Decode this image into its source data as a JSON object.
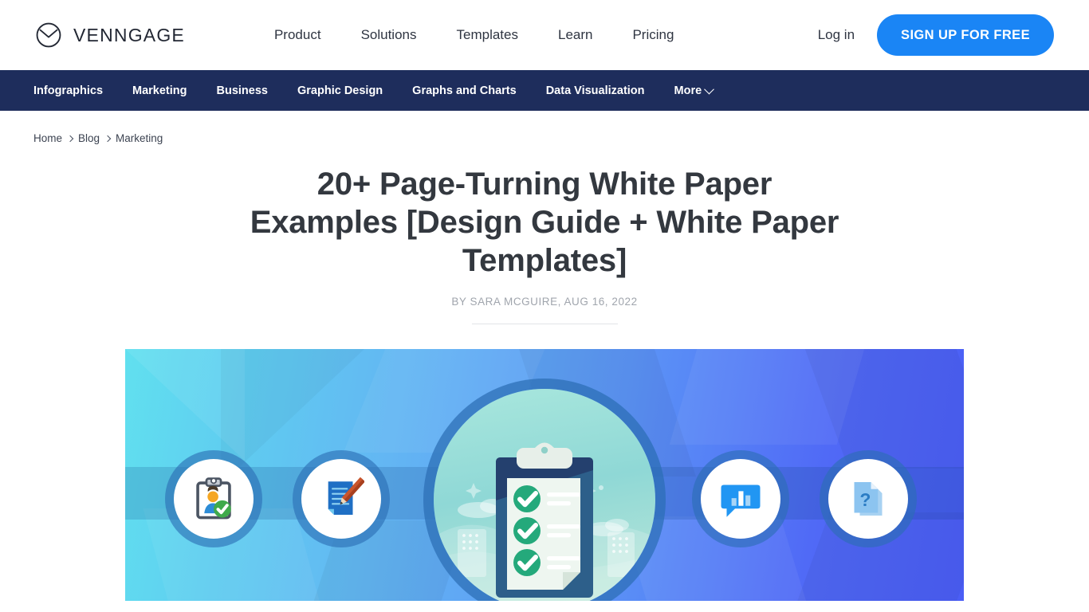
{
  "header": {
    "logo": {
      "icon": "venngage-circle-logo",
      "wordmark": "VENNGAGE"
    },
    "menu": [
      {
        "label": "Product"
      },
      {
        "label": "Solutions"
      },
      {
        "label": "Templates"
      },
      {
        "label": "Learn"
      },
      {
        "label": "Pricing"
      }
    ],
    "login_label": "Log in",
    "signup_label": "SIGN UP FOR FREE",
    "signup_color": "#1a85f5"
  },
  "subnav": {
    "background": "#1e2d5c",
    "items": [
      {
        "label": "Infographics",
        "has_chevron": false
      },
      {
        "label": "Marketing",
        "has_chevron": false
      },
      {
        "label": "Business",
        "has_chevron": false
      },
      {
        "label": "Graphic Design",
        "has_chevron": false
      },
      {
        "label": "Graphs and Charts",
        "has_chevron": false
      },
      {
        "label": "Data Visualization",
        "has_chevron": false
      },
      {
        "label": "More",
        "has_chevron": true
      }
    ]
  },
  "breadcrumb": {
    "items": [
      {
        "label": "Home"
      },
      {
        "label": "Blog"
      },
      {
        "label": "Marketing"
      }
    ]
  },
  "article": {
    "title": "20+ Page-Turning White Paper Examples [Design Guide + White Paper Templates]",
    "byline": "BY SARA MCGUIRE, AUG 16, 2022",
    "hero": {
      "gradient_from": "#61e0ef",
      "gradient_to": "#4b5ef6",
      "band_color": "#3a78b4",
      "icons": [
        {
          "name": "clipboard-person-verified-icon",
          "position": "left-outer"
        },
        {
          "name": "document-pencil-icon",
          "position": "left-inner"
        },
        {
          "name": "checklist-clipboard-icon",
          "position": "center"
        },
        {
          "name": "chat-bar-chart-icon",
          "position": "right-inner"
        },
        {
          "name": "documents-question-icon",
          "position": "right-outer"
        }
      ],
      "checklist_items": 3
    }
  }
}
